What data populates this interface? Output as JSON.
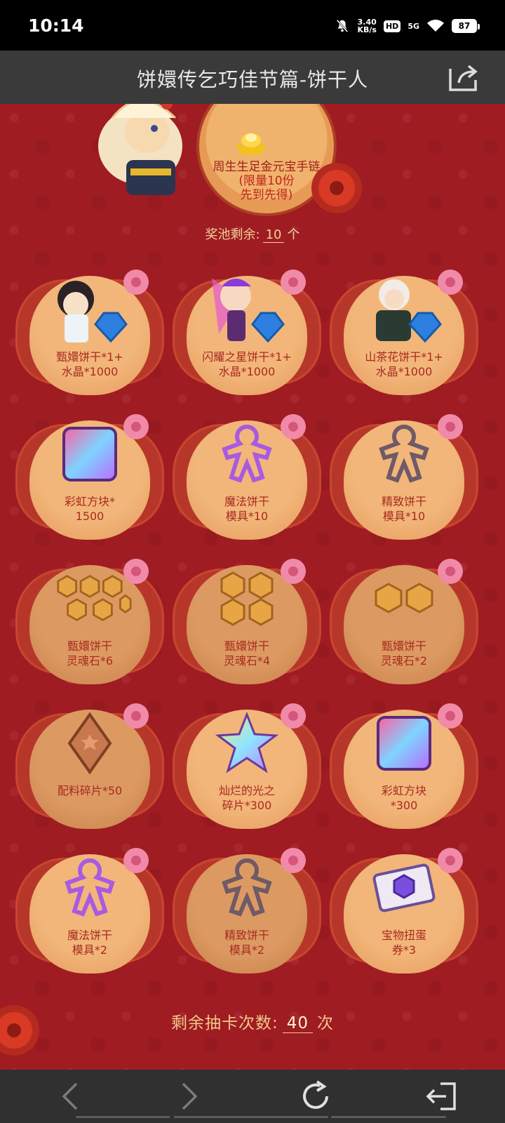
{
  "status_bar": {
    "time": "10:14",
    "net_speed_value": "3.40",
    "net_speed_unit": "KB/s",
    "hd": "HD",
    "network": "5G",
    "battery": "87"
  },
  "title_bar": {
    "title": "饼嬛传乞巧佳节篇-饼干人",
    "share_icon": "share-icon"
  },
  "hero_prize": {
    "name": "周生生足金元宝手链",
    "limit": "(限量10份",
    "note": "先到先得)"
  },
  "pool": {
    "prefix": "奖池剩余:",
    "count": "10",
    "suffix": "个"
  },
  "prizes": [
    {
      "line1": "甄嬛饼干*1+",
      "line2": "水晶*1000",
      "icon": "cookie-with-crystal-icon"
    },
    {
      "line1": "闪耀之星饼干*1+",
      "line2": "水晶*1000",
      "icon": "cookie-with-crystal-icon"
    },
    {
      "line1": "山茶花饼干*1+",
      "line2": "水晶*1000",
      "icon": "cookie-with-crystal-icon"
    },
    {
      "line1": "彩虹方块*",
      "line2": "1500",
      "icon": "rainbow-cube-icon"
    },
    {
      "line1": "魔法饼干",
      "line2": "模具*10",
      "icon": "magic-cutter-icon"
    },
    {
      "line1": "精致饼干",
      "line2": "模具*10",
      "icon": "fine-cutter-icon"
    },
    {
      "line1": "甄嬛饼干",
      "line2": "灵魂石*6",
      "icon": "soulstone-icon"
    },
    {
      "line1": "甄嬛饼干",
      "line2": "灵魂石*4",
      "icon": "soulstone-icon"
    },
    {
      "line1": "甄嬛饼干",
      "line2": "灵魂石*2",
      "icon": "soulstone-icon"
    },
    {
      "line1": "配料碎片*50",
      "line2": "",
      "icon": "topping-shard-icon"
    },
    {
      "line1": "灿烂的光之",
      "line2": "碎片*300",
      "icon": "star-shard-icon"
    },
    {
      "line1": "彩虹方块",
      "line2": "*300",
      "icon": "rainbow-cube-icon"
    },
    {
      "line1": "魔法饼干",
      "line2": "模具*2",
      "icon": "magic-cutter-icon"
    },
    {
      "line1": "精致饼干",
      "line2": "模具*2",
      "icon": "fine-cutter-icon"
    },
    {
      "line1": "宝物扭蛋",
      "line2": "券*3",
      "icon": "gacha-ticket-icon"
    }
  ],
  "draws": {
    "prefix": "剩余抽卡次数:",
    "count": "40",
    "suffix": "次"
  },
  "nav": {
    "back_icon": "chevron-left-icon",
    "forward_icon": "chevron-right-icon",
    "refresh_icon": "refresh-icon",
    "exit_icon": "exit-icon"
  }
}
